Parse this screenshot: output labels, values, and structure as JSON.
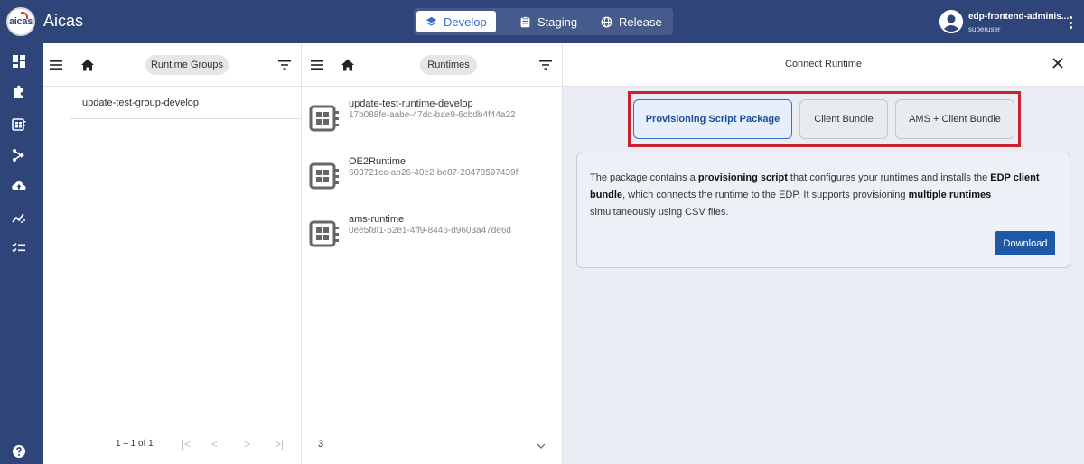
{
  "app": {
    "title": "Aicas",
    "logo_text": "aicas"
  },
  "envs": [
    {
      "label": "Develop",
      "icon": "layers-icon",
      "active": true
    },
    {
      "label": "Staging",
      "icon": "clipboard-icon",
      "active": false
    },
    {
      "label": "Release",
      "icon": "globe-icon",
      "active": false
    }
  ],
  "user": {
    "name": "edp-frontend-adminis...",
    "role": "superuser"
  },
  "groups_panel": {
    "chip": "Runtime Groups",
    "items": [
      "update-test-group-develop"
    ],
    "pager": {
      "count": "1 – 1 of 1",
      "first": "|<",
      "prev": "<",
      "next": ">",
      "last": ">|"
    }
  },
  "runtimes_panel": {
    "chip": "Runtimes",
    "items": [
      {
        "name": "update-test-runtime-develop",
        "id": "17b088fe-aabe-47dc-bae9-6cbdb4f44a22"
      },
      {
        "name": "OE2Runtime",
        "id": "603721cc-ab26-40e2-be87-20478597439f"
      },
      {
        "name": "ams-runtime",
        "id": "0ee5f8f1-52e1-4ff9-8446-d9603a47de6d"
      }
    ],
    "footer_count": "3"
  },
  "connect_panel": {
    "title": "Connect Runtime",
    "options": [
      "Provisioning Script Package",
      "Client Bundle",
      "AMS + Client Bundle"
    ],
    "selected_option": "Provisioning Script Package",
    "description": {
      "t1": "The package contains a ",
      "b1": "provisioning script",
      "t2": " that configures your runtimes and installs the ",
      "b2": "EDP client bundle",
      "t3": ", which connects the runtime to the EDP. It supports provisioning ",
      "b3": "multiple runtimes",
      "t4": " simultaneously using CSV files."
    },
    "download_label": "Download"
  },
  "colors": {
    "brand": "#2f4478",
    "accent": "#3470d3",
    "highlight": "#c8202e",
    "primary_button": "#1e59a8"
  }
}
